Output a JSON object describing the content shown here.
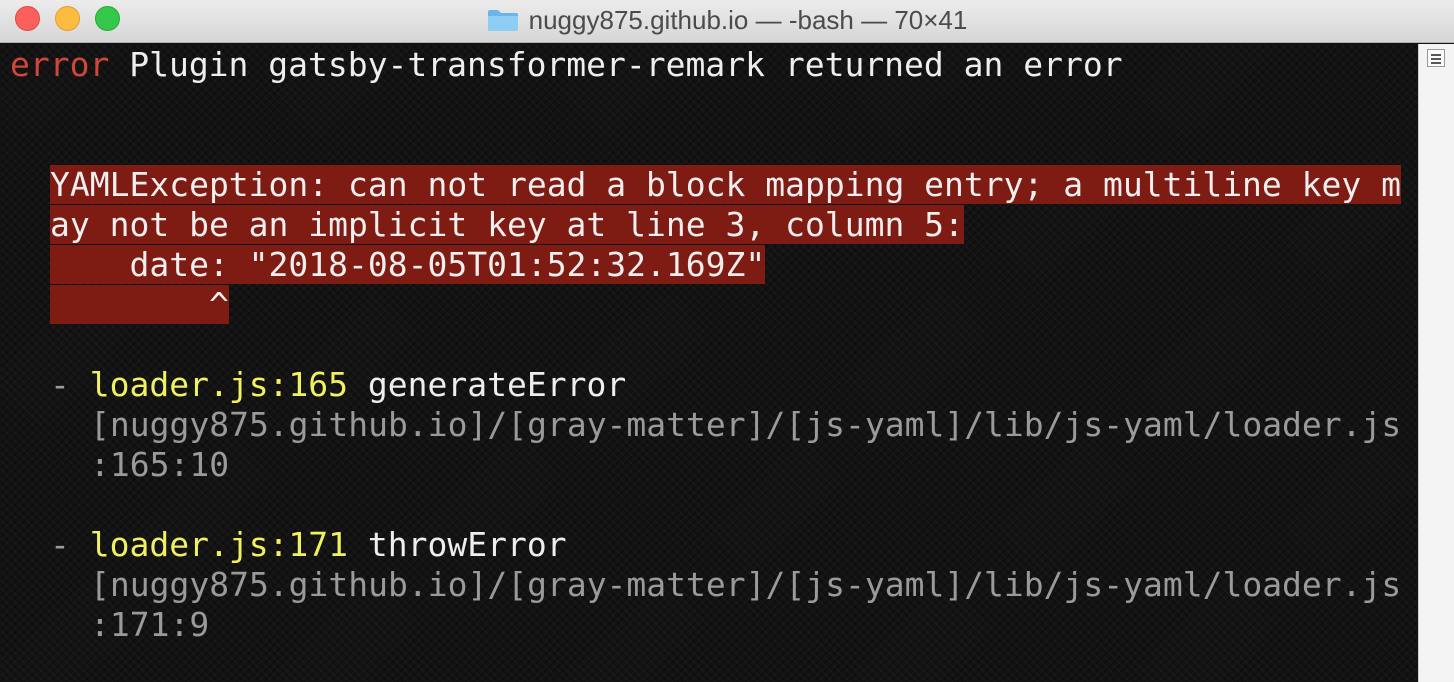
{
  "window": {
    "title": "nuggy875.github.io — -bash — 70×41",
    "folder_icon": "folder-icon"
  },
  "terminal": {
    "line1": {
      "prefix": "error",
      "message": " Plugin gatsby-transformer-remark returned an error"
    },
    "exception": {
      "line1": "YAMLException: can not read a block mapping entry; a multiline key m",
      "line2": "ay not be an implicit key at line 3, column 5:",
      "line3": "    date: \"2018-08-05T01:52:32.169Z\"",
      "line4": "        ^"
    },
    "stack": [
      {
        "dash": "- ",
        "file": "loader.js",
        "line_no": ":165",
        "func": " generateError",
        "path": "[nuggy875.github.io]/[gray-matter]/[js-yaml]/lib/js-yaml/loader.js",
        "loc": ":165:10"
      },
      {
        "dash": "- ",
        "file": "loader.js",
        "line_no": ":171",
        "func": " throwError",
        "path": "[nuggy875.github.io]/[gray-matter]/[js-yaml]/lib/js-yaml/loader.js",
        "loc": ":171:9"
      }
    ]
  },
  "colors": {
    "error_red": "#d0463a",
    "highlight_bg": "#7e1b13",
    "file_yellow": "#f0f060",
    "path_gray": "#9a9a9a"
  }
}
